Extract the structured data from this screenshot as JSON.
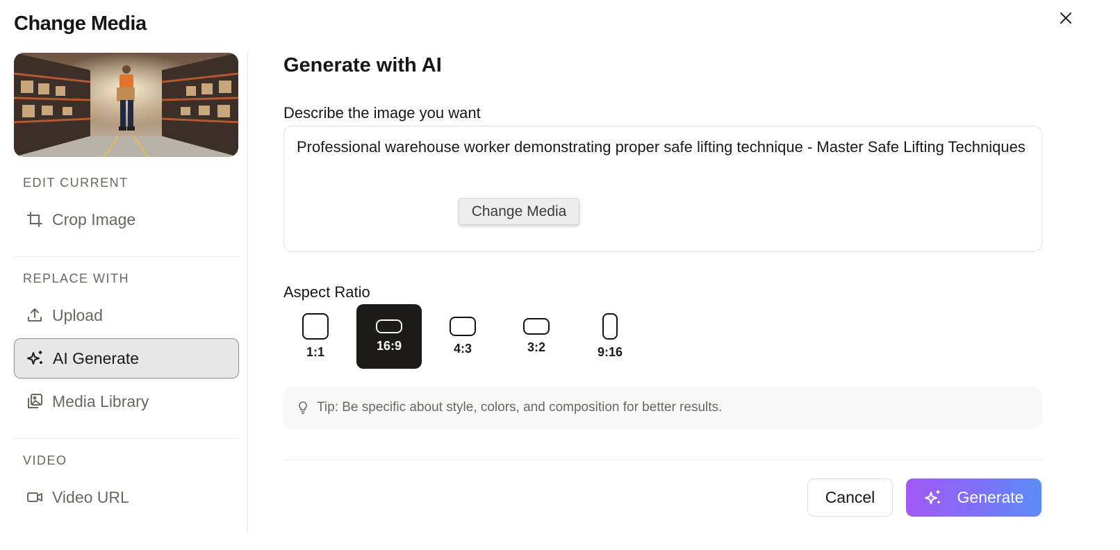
{
  "dialog": {
    "title": "Change Media"
  },
  "sidebar": {
    "thumbnail_alt": "Warehouse worker holding a box",
    "edit_label": "EDIT CURRENT",
    "crop_label": "Crop Image",
    "replace_label": "REPLACE WITH",
    "items": [
      {
        "label": "Upload",
        "icon": "upload-icon"
      },
      {
        "label": "AI Generate",
        "icon": "sparkles-icon",
        "active": true
      },
      {
        "label": "Media Library",
        "icon": "image-library-icon"
      }
    ],
    "video_label": "VIDEO",
    "video_url_label": "Video URL"
  },
  "main": {
    "title": "Generate with AI",
    "describe_label": "Describe the image you want",
    "prompt_value": "Professional warehouse worker demonstrating proper safe lifting technique - Master Safe Lifting Techniques",
    "tooltip": "Change Media",
    "aspect_label": "Aspect Ratio",
    "aspect_ratios": [
      {
        "label": "1:1"
      },
      {
        "label": "16:9",
        "selected": true
      },
      {
        "label": "4:3"
      },
      {
        "label": "3:2"
      },
      {
        "label": "9:16"
      }
    ],
    "tip": "Tip: Be specific about style, colors, and composition for better results."
  },
  "footer": {
    "cancel_label": "Cancel",
    "generate_label": "Generate"
  },
  "colors": {
    "accent_start": "#a259f7",
    "accent_end": "#5d8cf6",
    "selected_bg": "#1c1b19"
  }
}
